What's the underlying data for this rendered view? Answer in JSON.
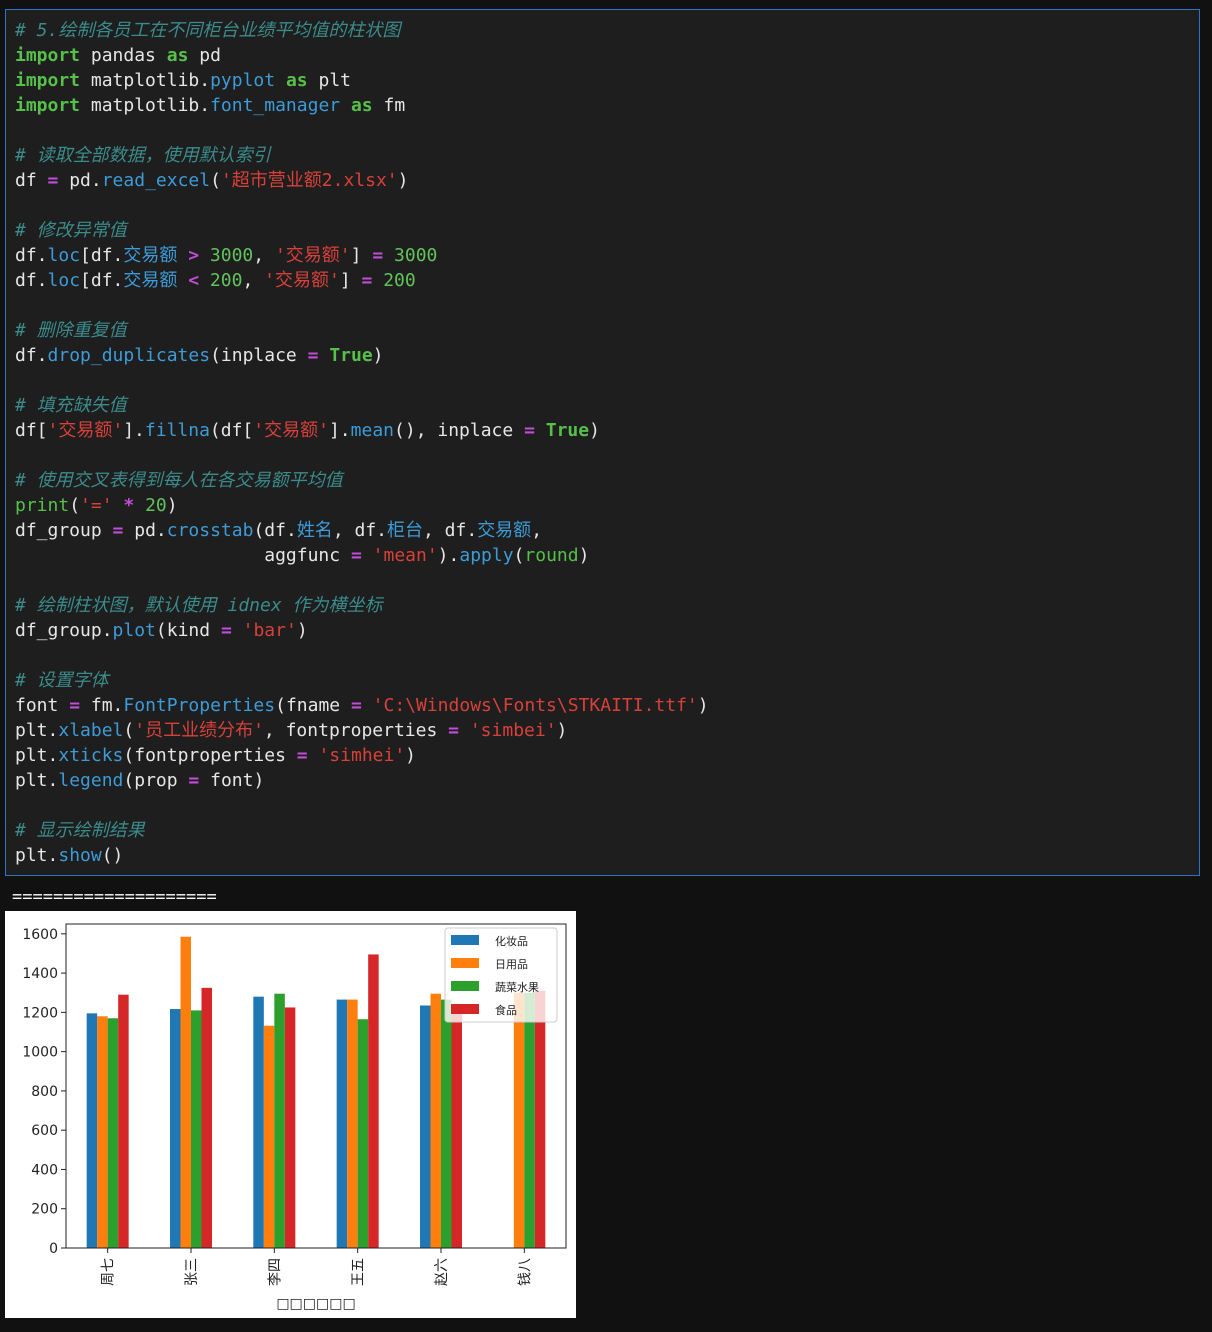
{
  "code_lines": [
    [
      {
        "t": "comment",
        "v": "# 5.绘制各员工在不同柜台业绩平均值的柱状图"
      }
    ],
    [
      {
        "t": "kw",
        "v": "import"
      },
      {
        "t": "name",
        "v": " pandas "
      },
      {
        "t": "kw",
        "v": "as"
      },
      {
        "t": "name",
        "v": " pd"
      }
    ],
    [
      {
        "t": "kw",
        "v": "import"
      },
      {
        "t": "name",
        "v": " matplotlib."
      },
      {
        "t": "func",
        "v": "pyplot"
      },
      {
        "t": "name",
        "v": " "
      },
      {
        "t": "kw",
        "v": "as"
      },
      {
        "t": "name",
        "v": " plt"
      }
    ],
    [
      {
        "t": "kw",
        "v": "import"
      },
      {
        "t": "name",
        "v": " matplotlib."
      },
      {
        "t": "func",
        "v": "font_manager"
      },
      {
        "t": "name",
        "v": " "
      },
      {
        "t": "kw",
        "v": "as"
      },
      {
        "t": "name",
        "v": " fm"
      }
    ],
    [],
    [
      {
        "t": "comment",
        "v": "# 读取全部数据，使用默认索引"
      }
    ],
    [
      {
        "t": "name",
        "v": "df "
      },
      {
        "t": "op",
        "v": "="
      },
      {
        "t": "name",
        "v": " pd."
      },
      {
        "t": "func",
        "v": "read_excel"
      },
      {
        "t": "punct",
        "v": "("
      },
      {
        "t": "str",
        "v": "'超市营业额2.xlsx'"
      },
      {
        "t": "punct",
        "v": ")"
      }
    ],
    [],
    [
      {
        "t": "comment",
        "v": "# 修改异常值"
      }
    ],
    [
      {
        "t": "name",
        "v": "df."
      },
      {
        "t": "func",
        "v": "loc"
      },
      {
        "t": "punct",
        "v": "[df."
      },
      {
        "t": "func",
        "v": "交易额"
      },
      {
        "t": "name",
        "v": " "
      },
      {
        "t": "op",
        "v": ">"
      },
      {
        "t": "name",
        "v": " "
      },
      {
        "t": "num",
        "v": "3000"
      },
      {
        "t": "punct",
        "v": ", "
      },
      {
        "t": "str",
        "v": "'交易额'"
      },
      {
        "t": "punct",
        "v": "] "
      },
      {
        "t": "op",
        "v": "="
      },
      {
        "t": "name",
        "v": " "
      },
      {
        "t": "num",
        "v": "3000"
      }
    ],
    [
      {
        "t": "name",
        "v": "df."
      },
      {
        "t": "func",
        "v": "loc"
      },
      {
        "t": "punct",
        "v": "[df."
      },
      {
        "t": "func",
        "v": "交易额"
      },
      {
        "t": "name",
        "v": " "
      },
      {
        "t": "op",
        "v": "<"
      },
      {
        "t": "name",
        "v": " "
      },
      {
        "t": "num",
        "v": "200"
      },
      {
        "t": "punct",
        "v": ", "
      },
      {
        "t": "str",
        "v": "'交易额'"
      },
      {
        "t": "punct",
        "v": "] "
      },
      {
        "t": "op",
        "v": "="
      },
      {
        "t": "name",
        "v": " "
      },
      {
        "t": "num",
        "v": "200"
      }
    ],
    [],
    [
      {
        "t": "comment",
        "v": "# 删除重复值"
      }
    ],
    [
      {
        "t": "name",
        "v": "df."
      },
      {
        "t": "func",
        "v": "drop_duplicates"
      },
      {
        "t": "punct",
        "v": "(inplace "
      },
      {
        "t": "op",
        "v": "="
      },
      {
        "t": "name",
        "v": " "
      },
      {
        "t": "kw",
        "v": "True"
      },
      {
        "t": "punct",
        "v": ")"
      }
    ],
    [],
    [
      {
        "t": "comment",
        "v": "# 填充缺失值"
      }
    ],
    [
      {
        "t": "name",
        "v": "df["
      },
      {
        "t": "str",
        "v": "'交易额'"
      },
      {
        "t": "punct",
        "v": "]."
      },
      {
        "t": "func",
        "v": "fillna"
      },
      {
        "t": "punct",
        "v": "(df["
      },
      {
        "t": "str",
        "v": "'交易额'"
      },
      {
        "t": "punct",
        "v": "]."
      },
      {
        "t": "func",
        "v": "mean"
      },
      {
        "t": "punct",
        "v": "(), inplace "
      },
      {
        "t": "op",
        "v": "="
      },
      {
        "t": "name",
        "v": " "
      },
      {
        "t": "kw",
        "v": "True"
      },
      {
        "t": "punct",
        "v": ")"
      }
    ],
    [],
    [
      {
        "t": "comment",
        "v": "# 使用交叉表得到每人在各交易额平均值"
      }
    ],
    [
      {
        "t": "builtin",
        "v": "print"
      },
      {
        "t": "punct",
        "v": "("
      },
      {
        "t": "str",
        "v": "'='"
      },
      {
        "t": "name",
        "v": " "
      },
      {
        "t": "op",
        "v": "*"
      },
      {
        "t": "name",
        "v": " "
      },
      {
        "t": "num",
        "v": "20"
      },
      {
        "t": "punct",
        "v": ")"
      }
    ],
    [
      {
        "t": "name",
        "v": "df_group "
      },
      {
        "t": "op",
        "v": "="
      },
      {
        "t": "name",
        "v": " pd."
      },
      {
        "t": "func",
        "v": "crosstab"
      },
      {
        "t": "punct",
        "v": "(df."
      },
      {
        "t": "func",
        "v": "姓名"
      },
      {
        "t": "punct",
        "v": ", df."
      },
      {
        "t": "func",
        "v": "柜台"
      },
      {
        "t": "punct",
        "v": ", df."
      },
      {
        "t": "func",
        "v": "交易额"
      },
      {
        "t": "punct",
        "v": ","
      }
    ],
    [
      {
        "t": "name",
        "v": "                       aggfunc "
      },
      {
        "t": "op",
        "v": "="
      },
      {
        "t": "name",
        "v": " "
      },
      {
        "t": "str",
        "v": "'mean'"
      },
      {
        "t": "punct",
        "v": ")."
      },
      {
        "t": "func",
        "v": "apply"
      },
      {
        "t": "punct",
        "v": "("
      },
      {
        "t": "builtin",
        "v": "round"
      },
      {
        "t": "punct",
        "v": ")"
      }
    ],
    [],
    [
      {
        "t": "comment",
        "v": "# 绘制柱状图，默认使用 idnex 作为横坐标"
      }
    ],
    [
      {
        "t": "name",
        "v": "df_group."
      },
      {
        "t": "func",
        "v": "plot"
      },
      {
        "t": "punct",
        "v": "(kind "
      },
      {
        "t": "op",
        "v": "="
      },
      {
        "t": "name",
        "v": " "
      },
      {
        "t": "str",
        "v": "'bar'"
      },
      {
        "t": "punct",
        "v": ")"
      }
    ],
    [],
    [
      {
        "t": "comment",
        "v": "# 设置字体"
      }
    ],
    [
      {
        "t": "name",
        "v": "font "
      },
      {
        "t": "op",
        "v": "="
      },
      {
        "t": "name",
        "v": " fm."
      },
      {
        "t": "func",
        "v": "FontProperties"
      },
      {
        "t": "punct",
        "v": "(fname "
      },
      {
        "t": "op",
        "v": "="
      },
      {
        "t": "name",
        "v": " "
      },
      {
        "t": "str",
        "v": "'C:\\Windows\\Fonts\\STKAITI.ttf'"
      },
      {
        "t": "punct",
        "v": ")"
      }
    ],
    [
      {
        "t": "name",
        "v": "plt."
      },
      {
        "t": "func",
        "v": "xlabel"
      },
      {
        "t": "punct",
        "v": "("
      },
      {
        "t": "str",
        "v": "'员工业绩分布'"
      },
      {
        "t": "punct",
        "v": ", fontproperties "
      },
      {
        "t": "op",
        "v": "="
      },
      {
        "t": "name",
        "v": " "
      },
      {
        "t": "str",
        "v": "'simbei'"
      },
      {
        "t": "punct",
        "v": ")"
      }
    ],
    [
      {
        "t": "name",
        "v": "plt."
      },
      {
        "t": "func",
        "v": "xticks"
      },
      {
        "t": "punct",
        "v": "(fontproperties "
      },
      {
        "t": "op",
        "v": "="
      },
      {
        "t": "name",
        "v": " "
      },
      {
        "t": "str",
        "v": "'simhei'"
      },
      {
        "t": "punct",
        "v": ")"
      }
    ],
    [
      {
        "t": "name",
        "v": "plt."
      },
      {
        "t": "func",
        "v": "legend"
      },
      {
        "t": "punct",
        "v": "(prop "
      },
      {
        "t": "op",
        "v": "="
      },
      {
        "t": "name",
        "v": " font)"
      }
    ],
    [],
    [
      {
        "t": "comment",
        "v": "# 显示绘制结果"
      }
    ],
    [
      {
        "t": "name",
        "v": "plt."
      },
      {
        "t": "func",
        "v": "show"
      },
      {
        "t": "punct",
        "v": "()"
      }
    ]
  ],
  "output_text": "====================",
  "colors": {
    "cell_border": "#2f72c4",
    "cell_bg": "#1e1e1e",
    "page_bg": "#111111"
  },
  "chart_data": {
    "type": "bar",
    "categories": [
      "周七",
      "张三",
      "李四",
      "王五",
      "赵六",
      "钱八"
    ],
    "series": [
      {
        "name": "化妆品",
        "color": "#1f77b4",
        "values": [
          1195,
          1217,
          1280,
          1265,
          1235,
          null
        ]
      },
      {
        "name": "日用品",
        "color": "#ff7f0e",
        "values": [
          1180,
          1585,
          1132,
          1265,
          1295,
          1300
        ]
      },
      {
        "name": "蔬菜水果",
        "color": "#2ca02c",
        "values": [
          1170,
          1210,
          1295,
          1165,
          1265,
          1300
        ]
      },
      {
        "name": "食品",
        "color": "#d62728",
        "values": [
          1290,
          1325,
          1225,
          1495,
          1220,
          1310
        ]
      }
    ],
    "ylim": [
      0,
      1650
    ],
    "yticks": [
      "0",
      "200",
      "400",
      "600",
      "800",
      "1000",
      "1200",
      "1400",
      "1600"
    ],
    "xlabel": "□□□□□□",
    "ylabel": "",
    "title": "",
    "legend_position": "upper-right",
    "grid": false
  }
}
